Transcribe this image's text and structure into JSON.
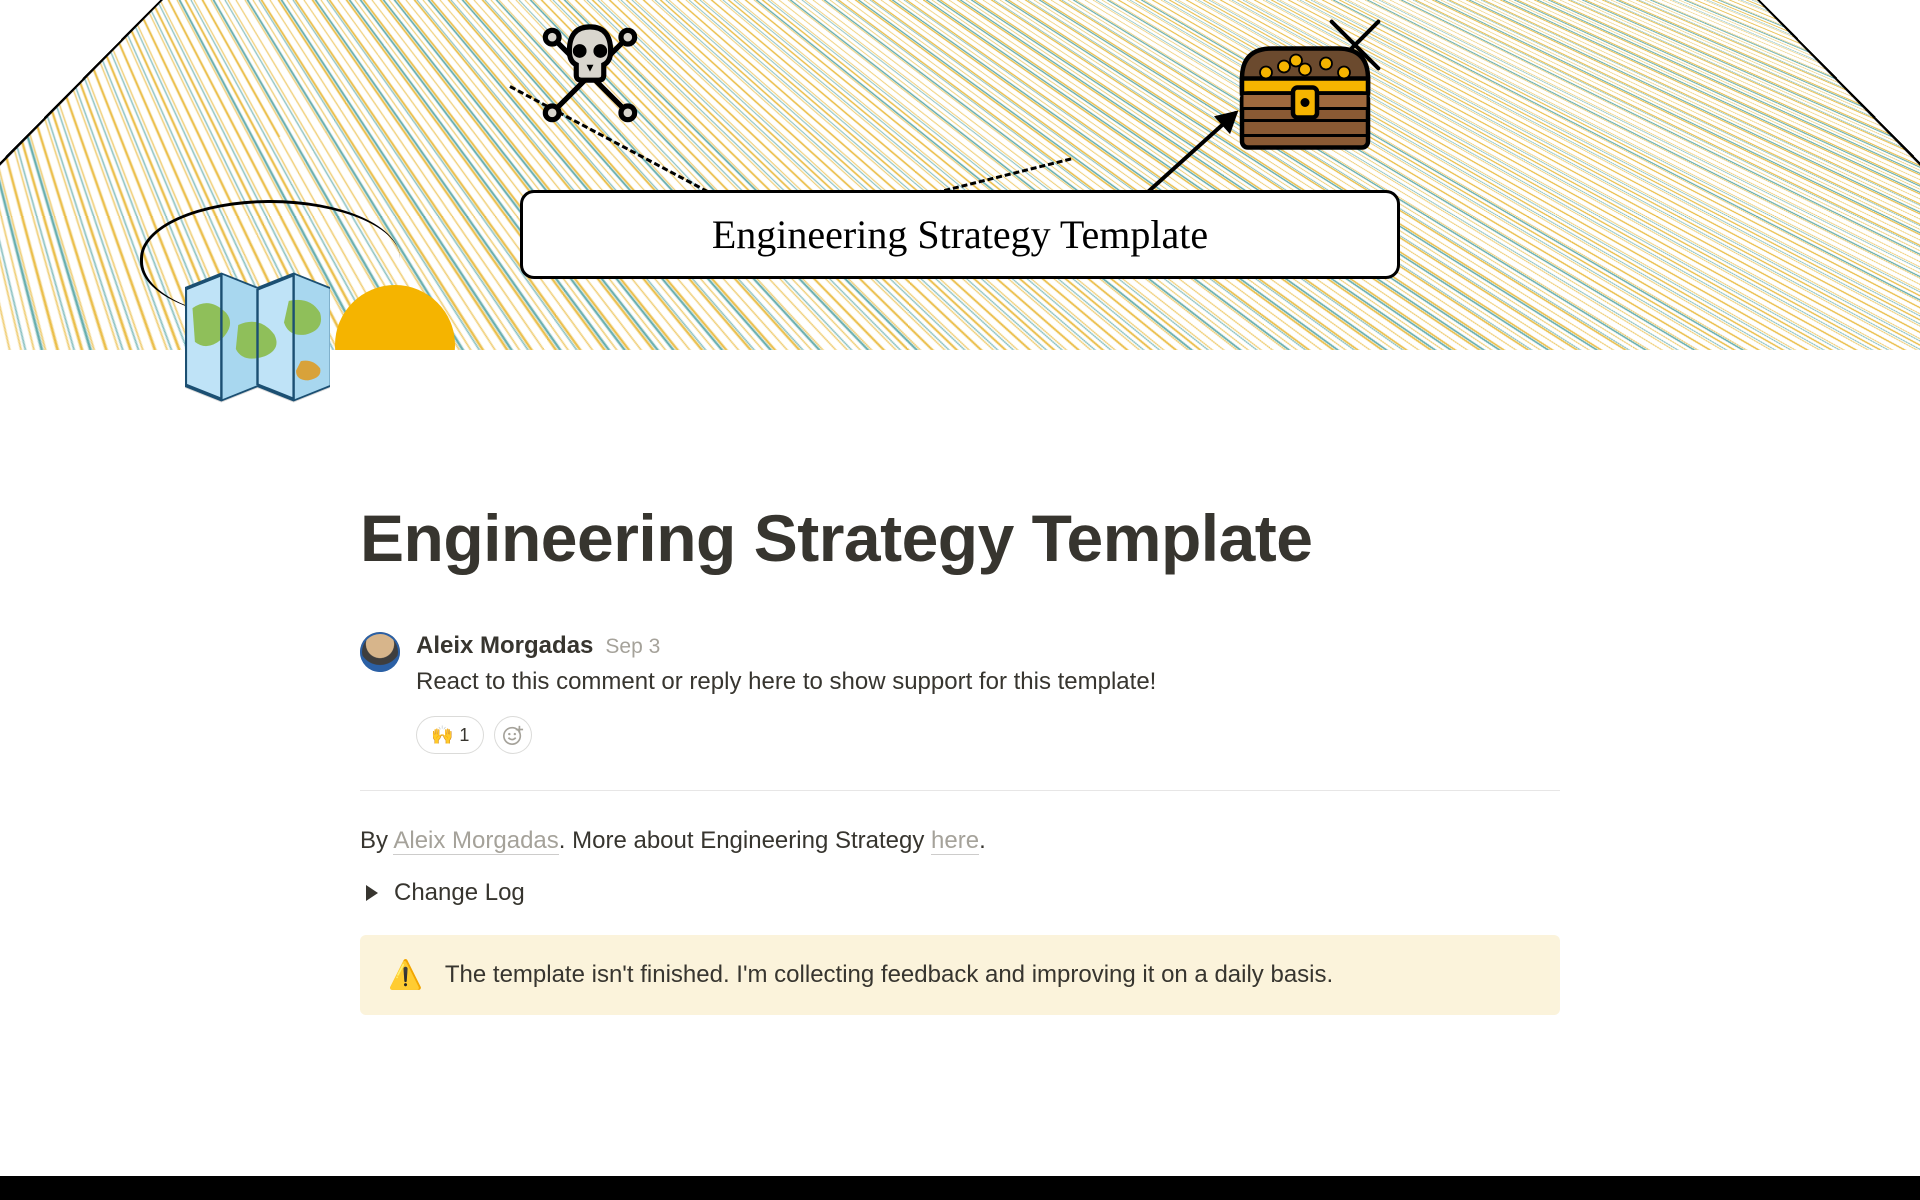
{
  "cover": {
    "banner_text": "Engineering Strategy Template"
  },
  "page": {
    "title": "Engineering Strategy Template"
  },
  "comment": {
    "author": "Aleix Morgadas",
    "date": "Sep 3",
    "text": "React to this comment or reply here to show support for this template!",
    "reaction": {
      "emoji": "🙌",
      "count": "1"
    }
  },
  "byline": {
    "prefix": "By ",
    "author_link": "Aleix Morgadas",
    "mid": ". More about Engineering Strategy ",
    "here": "here",
    "suffix": "."
  },
  "toggle": {
    "label": "Change Log"
  },
  "callout": {
    "icon": "⚠️",
    "text": "The template isn't finished. I'm collecting feedback and improving it on a daily basis."
  }
}
